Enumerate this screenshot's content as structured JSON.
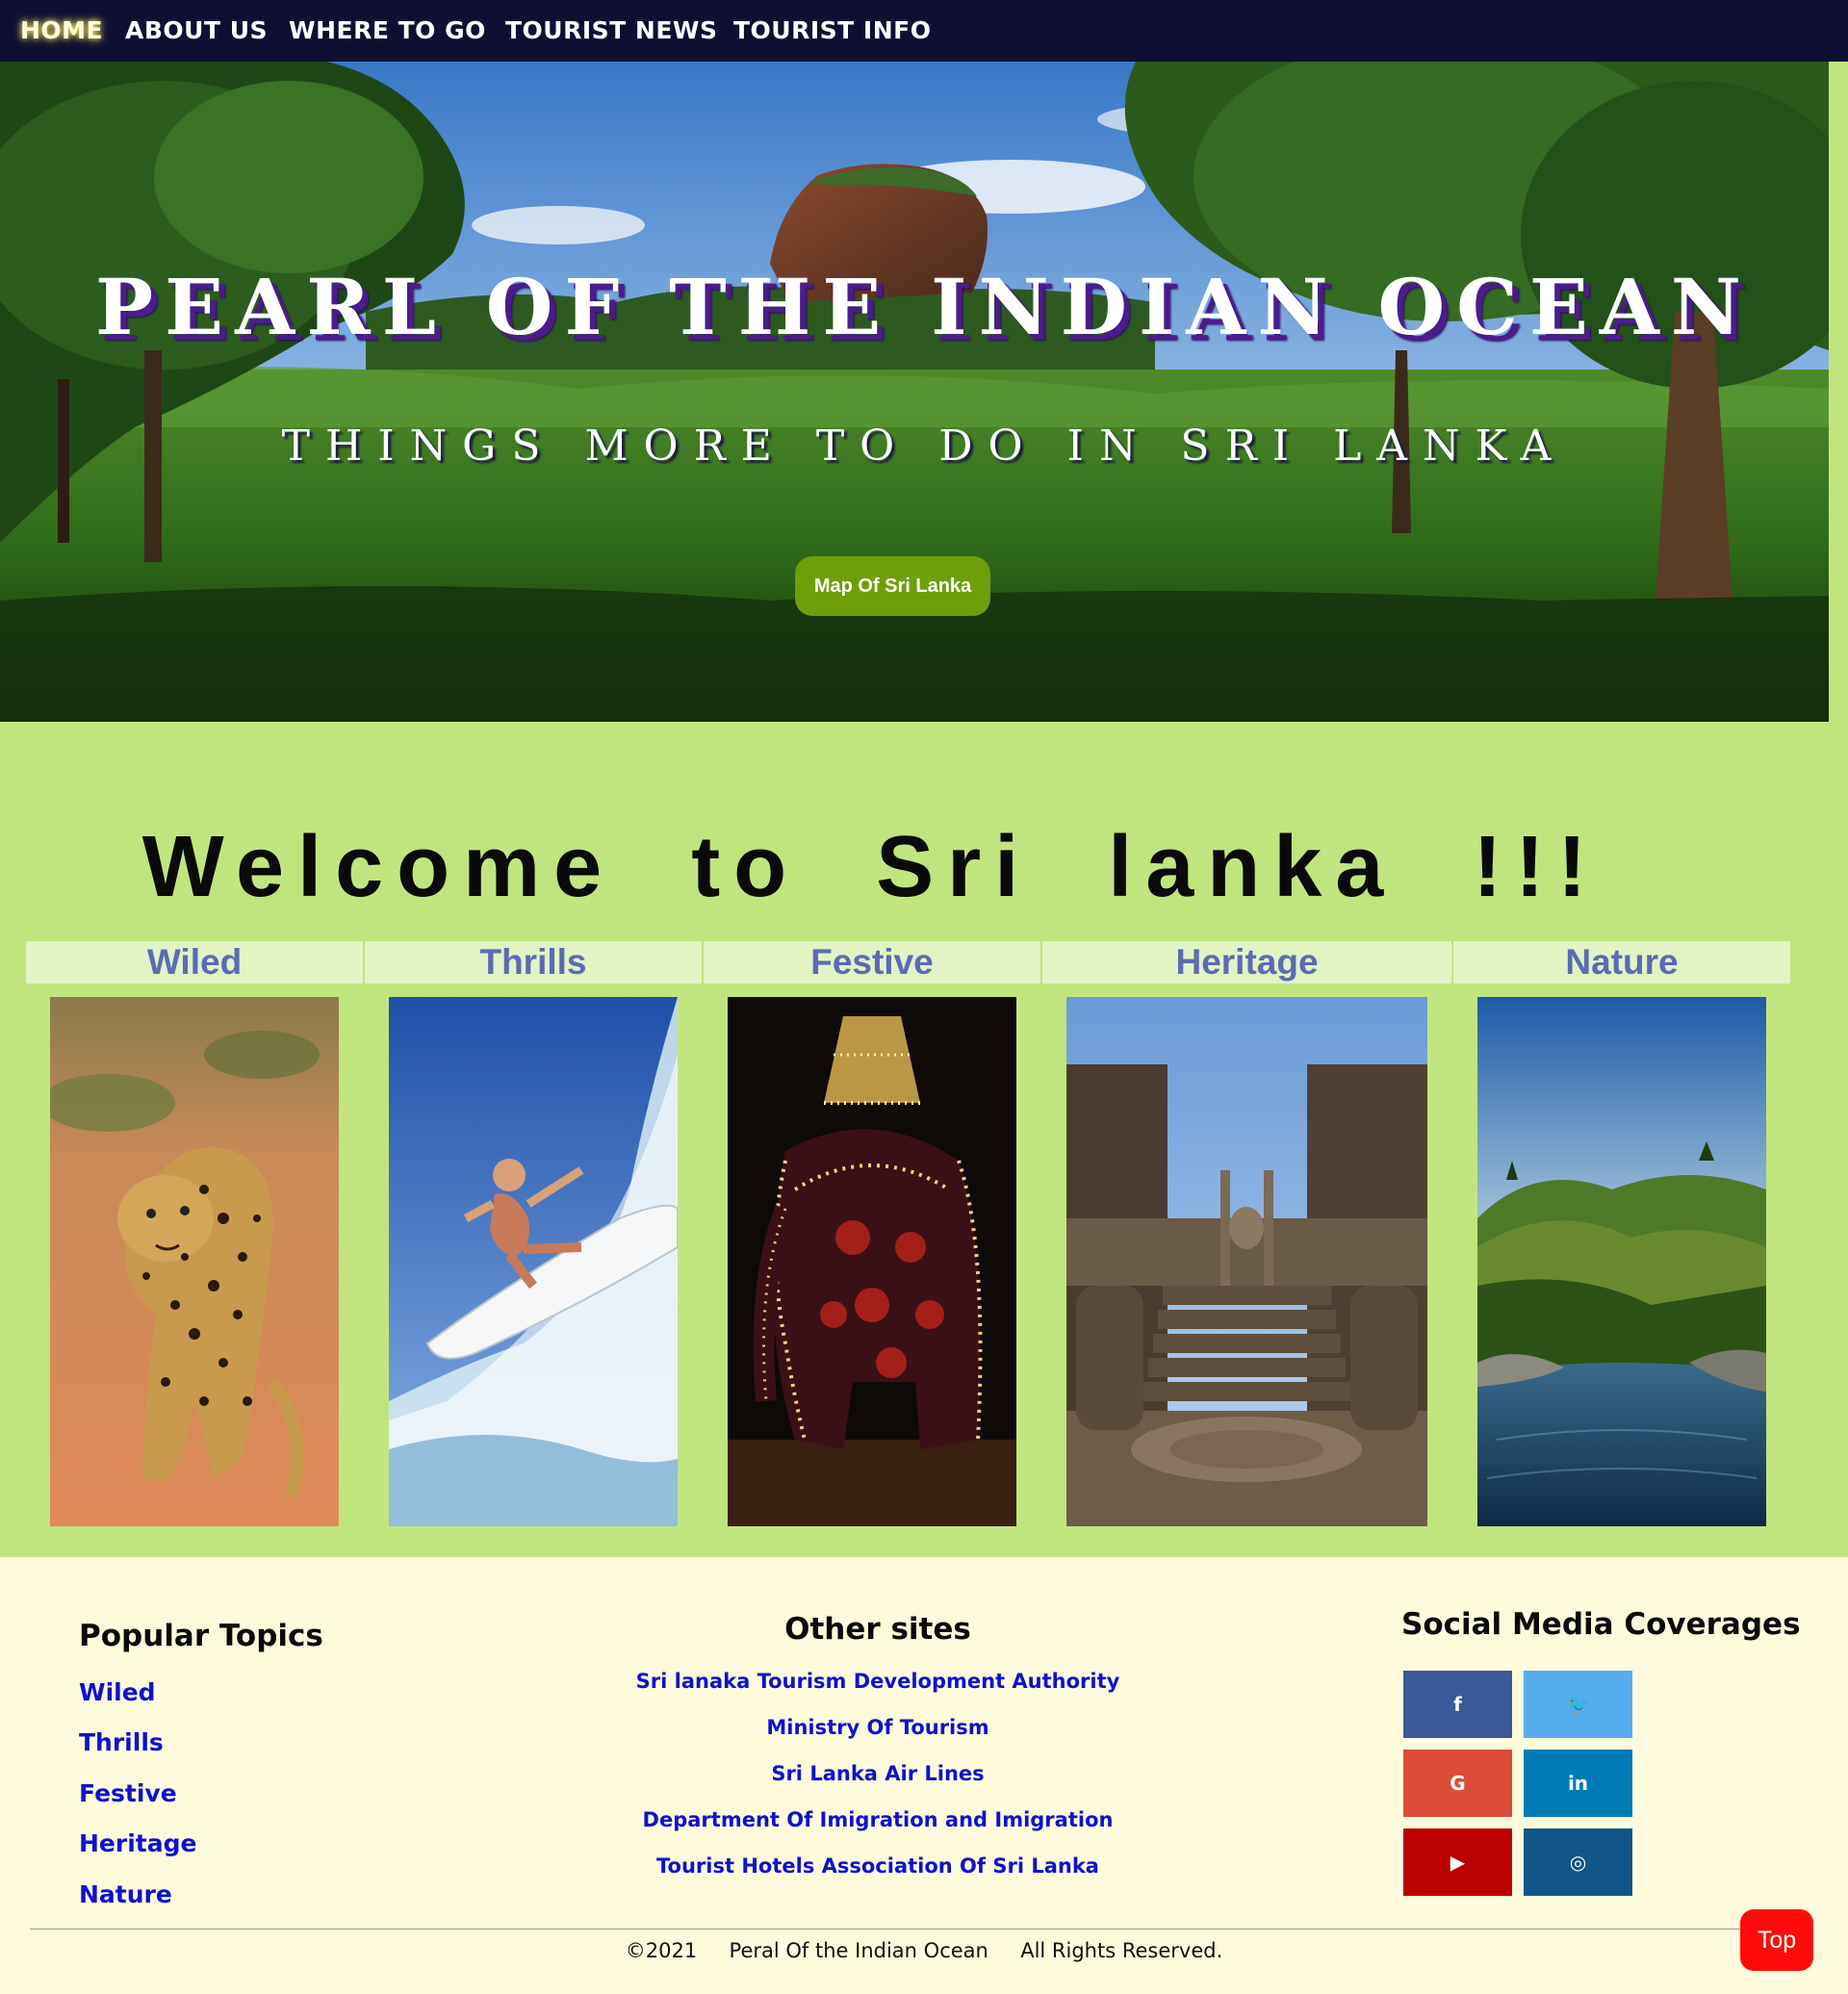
{
  "nav": {
    "items": [
      {
        "label": "HOME",
        "active": true
      },
      {
        "label": "ABOUT US"
      },
      {
        "label": "WHERE TO GO"
      },
      {
        "label": "TOURIST NEWS"
      },
      {
        "label": "TOURIST INFO"
      }
    ]
  },
  "hero": {
    "title": "PEARL OF THE INDIAN OCEAN",
    "subtitle": "THINGS MORE TO DO IN SRI LANKA",
    "map_button_label": "Map Of Sri Lanka"
  },
  "welcome": {
    "title": "Welcome to Sri lanka !!!",
    "categories": [
      {
        "label": "Wiled"
      },
      {
        "label": "Thrills"
      },
      {
        "label": "Festive"
      },
      {
        "label": "Heritage"
      },
      {
        "label": "Nature"
      }
    ]
  },
  "footer": {
    "popular_topics": {
      "heading": "Popular Topics",
      "links": [
        "Wiled",
        "Thrills",
        "Festive",
        "Heritage",
        "Nature"
      ]
    },
    "other_sites": {
      "heading": "Other sites",
      "links": [
        "Sri lanaka Tourism Development Authority",
        "Ministry Of Tourism",
        "Sri Lanka Air Lines",
        "Department Of Imigration and Imigration",
        "Tourist Hotels Association Of Sri Lanka"
      ]
    },
    "social": {
      "heading": "Social Media Coverages",
      "buttons": [
        {
          "icon": "facebook-icon",
          "glyph": "f",
          "color": "#3b5998"
        },
        {
          "icon": "twitter-icon",
          "glyph": "🐦",
          "color": "#55acee"
        },
        {
          "icon": "google-icon",
          "glyph": "G",
          "color": "#dd4b39"
        },
        {
          "icon": "linkedin-icon",
          "glyph": "in",
          "color": "#007bb5"
        },
        {
          "icon": "youtube-icon",
          "glyph": "▶",
          "color": "#bb0000"
        },
        {
          "icon": "instagram-icon",
          "glyph": "◎",
          "color": "#125688"
        }
      ]
    },
    "copyright": "©2021     Peral Of the Indian Ocean     All Rights Reserved.",
    "top_button_label": "Top"
  },
  "colors": {
    "nav_bg": "#0f0f33",
    "welcome_bg": "#c1e57e",
    "footer_bg": "#fdfbdb",
    "link": "#1010d0",
    "map_button": "#6f9e0b",
    "top_button": "#ff0b0b"
  }
}
